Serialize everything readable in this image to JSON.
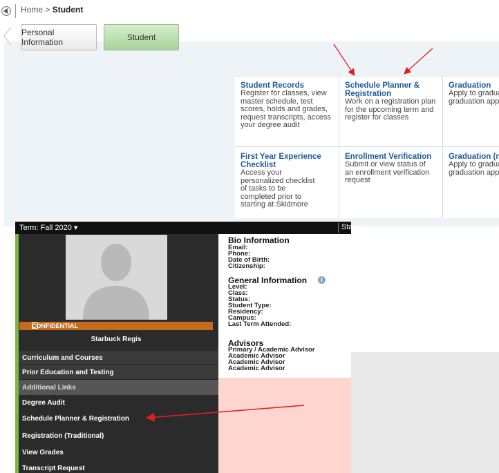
{
  "breadcrumb": {
    "home": "Home",
    "separator": ">",
    "current": "Student"
  },
  "tabs": [
    {
      "label": "Personal Information"
    },
    {
      "label": "Student"
    }
  ],
  "cards": [
    {
      "title": "Student Records",
      "desc": "Register for classes, view master schedule, test scores, holds and grades, request transcripts, access your degree audit"
    },
    {
      "title": "Schedule Planner & Registration",
      "desc": "Work on a registration plan for the upcoming term and register for classes"
    },
    {
      "title": "Graduation",
      "desc": "Apply to graduate graduation applica"
    },
    {
      "title": "First Year Experience Checklist",
      "desc": "Access your personalized checklist of tasks to be completed prior to starting at Skidmore"
    },
    {
      "title": "Enrollment Verification",
      "desc": "Submit or view status of an enrollment verification request"
    },
    {
      "title": "Graduation (new)",
      "desc": "Apply to graduate graduation applica"
    }
  ],
  "term": {
    "label": "Term: Fall 2020",
    "right": "Stanc"
  },
  "profile": {
    "confidential": "CONFIDENTIAL",
    "name": "Starbuck Regis"
  },
  "menu": {
    "items": [
      "Curriculum and Courses",
      "Prior Education and Testing",
      "Additional Links",
      "Degree Audit",
      "Schedule Planner & Registration",
      "Registration (Traditional)",
      "View Grades",
      "Transcript Request"
    ]
  },
  "bio": {
    "title": "Bio Information",
    "fields": [
      "Email:",
      "Phone:",
      "Date of Birth:",
      "Citizenship:"
    ]
  },
  "general": {
    "title": "General Information",
    "fields": [
      "Level:",
      "Class:",
      "Status:",
      "Student Type:",
      "Residency:",
      "Campus:",
      "Last Term Attended:"
    ]
  },
  "advisors": {
    "title": "Advisors",
    "fields": [
      "Primary / Academic Advisor",
      "Academic Advisor",
      "Academic Advisor",
      "Academic Advisor"
    ]
  },
  "colors": {
    "accent_green": "#7ab648",
    "link_blue": "#1e5a9a",
    "confidential_orange": "#c56a1e",
    "annotation_red": "#e02020"
  }
}
